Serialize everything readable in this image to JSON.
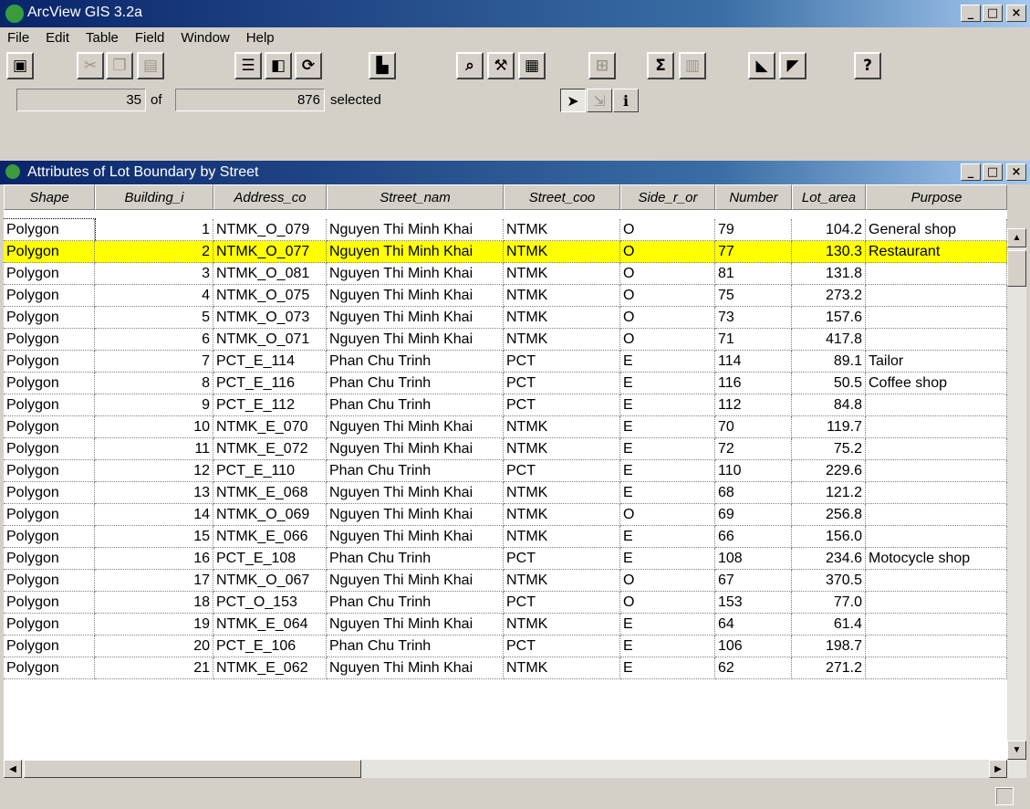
{
  "app": {
    "title": "ArcView GIS 3.2a"
  },
  "window_buttons": {
    "minimize": "_",
    "maximize": "□",
    "close": "×"
  },
  "menu": [
    "File",
    "Edit",
    "Table",
    "Field",
    "Window",
    "Help"
  ],
  "selection": {
    "selected": "35",
    "of_label": "of",
    "total": "876",
    "selected_label": "selected"
  },
  "table_window": {
    "title": "Attributes of Lot Boundary by Street"
  },
  "columns": [
    "Shape",
    "Building_i",
    "Address_co",
    "Street_nam",
    "Street_coo",
    "Side_r_or",
    "Number",
    "Lot_area",
    "Purpose"
  ],
  "rows": [
    [
      "Polygon",
      "1",
      "NTMK_O_079",
      "Nguyen Thi Minh Khai",
      "NTMK",
      "O",
      "79",
      "104.2",
      "General shop"
    ],
    [
      "Polygon",
      "2",
      "NTMK_O_077",
      "Nguyen Thi Minh Khai",
      "NTMK",
      "O",
      "77",
      "130.3",
      "Restaurant"
    ],
    [
      "Polygon",
      "3",
      "NTMK_O_081",
      "Nguyen Thi Minh Khai",
      "NTMK",
      "O",
      "81",
      "131.8",
      ""
    ],
    [
      "Polygon",
      "4",
      "NTMK_O_075",
      "Nguyen Thi Minh Khai",
      "NTMK",
      "O",
      "75",
      "273.2",
      ""
    ],
    [
      "Polygon",
      "5",
      "NTMK_O_073",
      "Nguyen Thi Minh Khai",
      "NTMK",
      "O",
      "73",
      "157.6",
      ""
    ],
    [
      "Polygon",
      "6",
      "NTMK_O_071",
      "Nguyen Thi Minh Khai",
      "NTMK",
      "O",
      "71",
      "417.8",
      ""
    ],
    [
      "Polygon",
      "7",
      "PCT_E_114",
      "Phan Chu Trinh",
      "PCT",
      "E",
      "114",
      "89.1",
      "Tailor"
    ],
    [
      "Polygon",
      "8",
      "PCT_E_116",
      "Phan Chu Trinh",
      "PCT",
      "E",
      "116",
      "50.5",
      "Coffee shop"
    ],
    [
      "Polygon",
      "9",
      "PCT_E_112",
      "Phan Chu Trinh",
      "PCT",
      "E",
      "112",
      "84.8",
      ""
    ],
    [
      "Polygon",
      "10",
      "NTMK_E_070",
      "Nguyen Thi Minh Khai",
      "NTMK",
      "E",
      "70",
      "119.7",
      ""
    ],
    [
      "Polygon",
      "11",
      "NTMK_E_072",
      "Nguyen Thi Minh Khai",
      "NTMK",
      "E",
      "72",
      "75.2",
      ""
    ],
    [
      "Polygon",
      "12",
      "PCT_E_110",
      "Phan Chu Trinh",
      "PCT",
      "E",
      "110",
      "229.6",
      ""
    ],
    [
      "Polygon",
      "13",
      "NTMK_E_068",
      "Nguyen Thi Minh Khai",
      "NTMK",
      "E",
      "68",
      "121.2",
      ""
    ],
    [
      "Polygon",
      "14",
      "NTMK_O_069",
      "Nguyen Thi Minh Khai",
      "NTMK",
      "O",
      "69",
      "256.8",
      ""
    ],
    [
      "Polygon",
      "15",
      "NTMK_E_066",
      "Nguyen Thi Minh Khai",
      "NTMK",
      "E",
      "66",
      "156.0",
      ""
    ],
    [
      "Polygon",
      "16",
      "PCT_E_108",
      "Phan Chu Trinh",
      "PCT",
      "E",
      "108",
      "234.6",
      "Motocycle shop"
    ],
    [
      "Polygon",
      "17",
      "NTMK_O_067",
      "Nguyen Thi Minh Khai",
      "NTMK",
      "O",
      "67",
      "370.5",
      ""
    ],
    [
      "Polygon",
      "18",
      "PCT_O_153",
      "Phan Chu Trinh",
      "PCT",
      "O",
      "153",
      "77.0",
      ""
    ],
    [
      "Polygon",
      "19",
      "NTMK_E_064",
      "Nguyen Thi Minh Khai",
      "NTMK",
      "E",
      "64",
      "61.4",
      ""
    ],
    [
      "Polygon",
      "20",
      "PCT_E_106",
      "Phan Chu Trinh",
      "PCT",
      "E",
      "106",
      "198.7",
      ""
    ],
    [
      "Polygon",
      "21",
      "NTMK_E_062",
      "Nguyen Thi Minh Khai",
      "NTMK",
      "E",
      "62",
      "271.2",
      ""
    ]
  ],
  "selected_row_index": 1,
  "colors": {
    "title_gradient_start": "#0a246a",
    "selection_highlight": "#ffff00",
    "face": "#d4d0c8"
  },
  "toolbar_icons": [
    "save-icon",
    "cut-icon",
    "copy-icon",
    "paste-icon",
    "properties-icon",
    "select-all-icon",
    "refresh-icon",
    "chart-icon",
    "find-icon",
    "query-icon",
    "promote-icon",
    "join-icon",
    "summarize-icon",
    "calculate-icon",
    "sort-ascending-icon",
    "sort-descending-icon",
    "help-icon"
  ]
}
